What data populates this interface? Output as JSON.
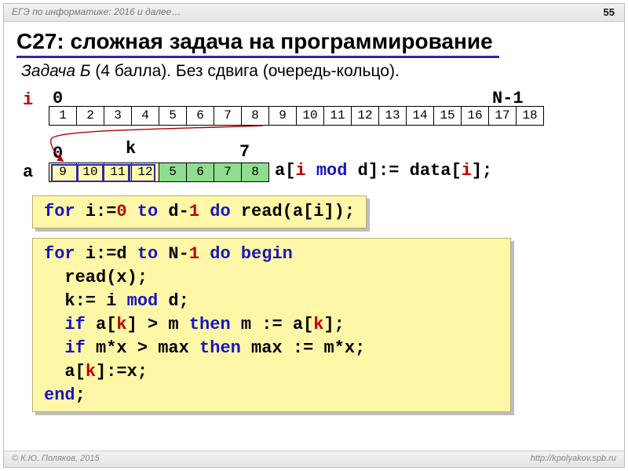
{
  "header": {
    "text": "ЕГЭ по информатике: 2016 и далее…",
    "page": "55"
  },
  "title": "C27: сложная задача на программирование",
  "subtitle": {
    "italic": "Задача Б",
    "rest": " (4 балла). Без сдвига (очередь-кольцо)."
  },
  "labels": {
    "i": "i",
    "zero": "0",
    "nminus1": "N-1",
    "a": "a",
    "a_zero": "0",
    "a_k": "k",
    "a_seven": "7"
  },
  "strip": [
    "1",
    "2",
    "3",
    "4",
    "5",
    "6",
    "7",
    "8",
    "9",
    "10",
    "11",
    "12",
    "13",
    "14",
    "15",
    "16",
    "17",
    "18"
  ],
  "arr": [
    {
      "v": "9",
      "cls": "y"
    },
    {
      "v": "10",
      "cls": "y"
    },
    {
      "v": "11",
      "cls": "y"
    },
    {
      "v": "12",
      "cls": "y"
    },
    {
      "v": "5",
      "cls": "g"
    },
    {
      "v": "6",
      "cls": "g"
    },
    {
      "v": "7",
      "cls": "g"
    },
    {
      "v": "8",
      "cls": "g"
    }
  ],
  "expr": {
    "p1": "a[",
    "p2": "i",
    "p3": " ",
    "p4": "mod",
    "p5": " ",
    "p6": "d",
    "p7": "]:= data[",
    "p8": "i",
    "p9": "];"
  },
  "code1": {
    "t1": "for",
    "t2": " i:=",
    "t3": "0",
    "t4": " ",
    "t5": "to",
    "t6": " d-",
    "t7": "1",
    "t8": " ",
    "t9": "do",
    "t10": " read(a[i]);"
  },
  "code2": {
    "l1a": "for",
    "l1b": " i:=d ",
    "l1c": "to",
    "l1d": " N-",
    "l1e": "1",
    "l1f": " ",
    "l1g": "do",
    "l1h": " ",
    "l1i": "begin",
    "l2": "  read(x);",
    "l3a": "  k:= i ",
    "l3b": "mod",
    "l3c": " d;",
    "l4a": "  ",
    "l4b": "if",
    "l4c": " a[",
    "l4d": "k",
    "l4e": "] > m ",
    "l4f": "then",
    "l4g": " m := a[",
    "l4h": "k",
    "l4i": "];",
    "l5a": "  ",
    "l5b": "if",
    "l5c": " m*x > max ",
    "l5d": "then",
    "l5e": " max := m*x;",
    "l6a": "  a[",
    "l6b": "k",
    "l6c": "]:=x;",
    "l7": "end",
    "l7b": ";"
  },
  "footer": {
    "left": "© К.Ю. Поляков, 2015",
    "right": "http://kpolyakov.spb.ru"
  }
}
